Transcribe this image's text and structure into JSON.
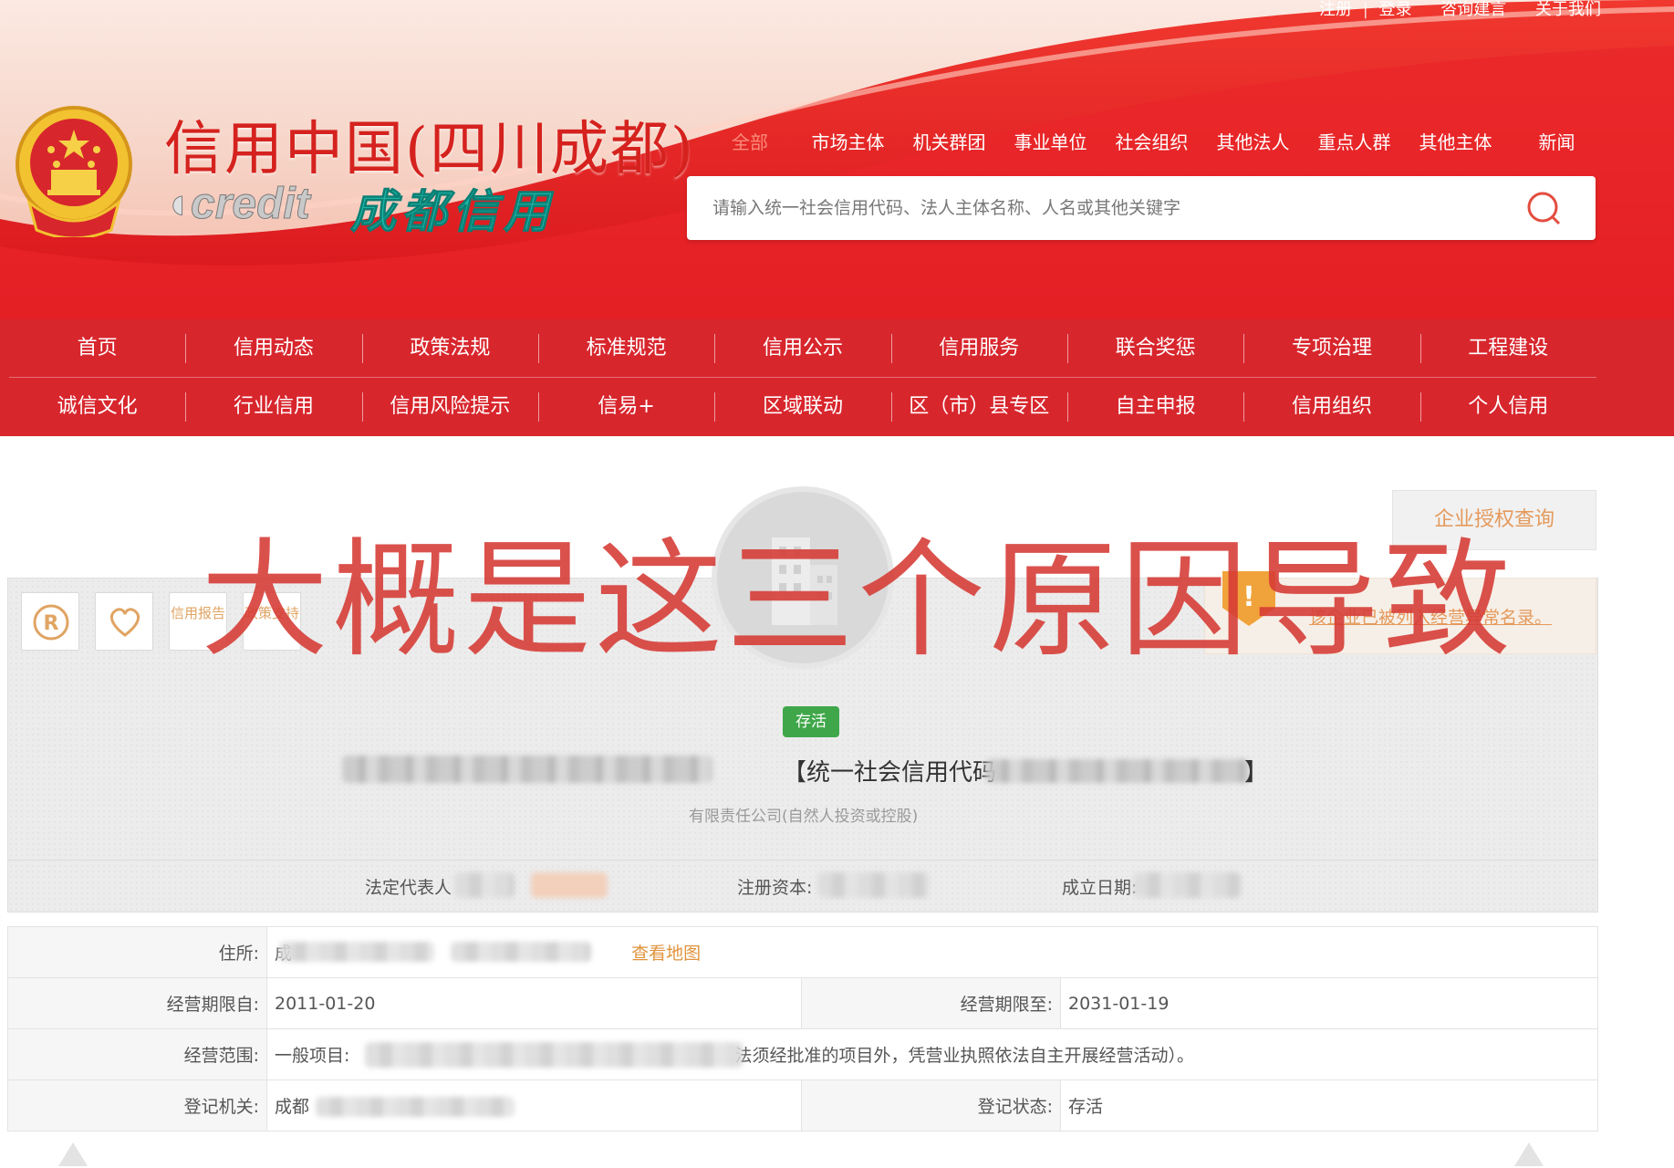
{
  "header": {
    "toplinks": [
      "注册",
      "登录",
      "咨询建言",
      "关于我们"
    ],
    "site_title": "信用中国(四川成都)",
    "logo_credit": "credit",
    "logo_city": "成都信用",
    "category_tabs": [
      "全部",
      "市场主体",
      "机关群团",
      "事业单位",
      "社会组织",
      "其他法人",
      "重点人群",
      "其他主体",
      "新闻"
    ],
    "search_placeholder": "请输入统一社会信用代码、法人主体名称、人名或其他关键字"
  },
  "nav": {
    "row1": [
      "首页",
      "信用动态",
      "政策法规",
      "标准规范",
      "信用公示",
      "信用服务",
      "联合奖惩",
      "专项治理",
      "工程建设"
    ],
    "row2": [
      "诚信文化",
      "行业信用",
      "信用风险提示",
      "信易+",
      "区域联动",
      "区（市）县专区",
      "自主申报",
      "信用组织",
      "个人信用"
    ]
  },
  "profile": {
    "auth_button": "企业授权查询",
    "tool_credit_report": "信用报告",
    "tool_policy_support": "政策支持",
    "warning_text": "该企业已被列入经营异常名录。",
    "status": "存活",
    "credit_code_label": "【统一社会信用代码",
    "credit_code_close": "】",
    "company_type": "有限责任公司(自然人投资或控股)",
    "legal_rep_label": "法定代表人",
    "capital_label": "注册资本:",
    "founded_label": "成立日期:"
  },
  "table": {
    "address_label": "住所:",
    "address_prefix": "成",
    "map_link": "查看地图",
    "term_from_label": "经营期限自:",
    "term_from": "2011-01-20",
    "term_to_label": "经营期限至:",
    "term_to": "2031-01-19",
    "scope_label": "经营范围:",
    "scope_prefix": "一般项目:",
    "scope_suffix": "法须经批准的项目外，凭营业执照依法自主开展经营活动）。",
    "authority_label": "登记机关:",
    "authority_prefix": "成都",
    "reg_status_label": "登记状态:",
    "reg_status": "存活"
  },
  "watermark": "大概是这三个原因导致",
  "colors": {
    "brand_red": "#d8262d",
    "accent_orange": "#e49a5c",
    "status_green": "#3fa74a"
  }
}
